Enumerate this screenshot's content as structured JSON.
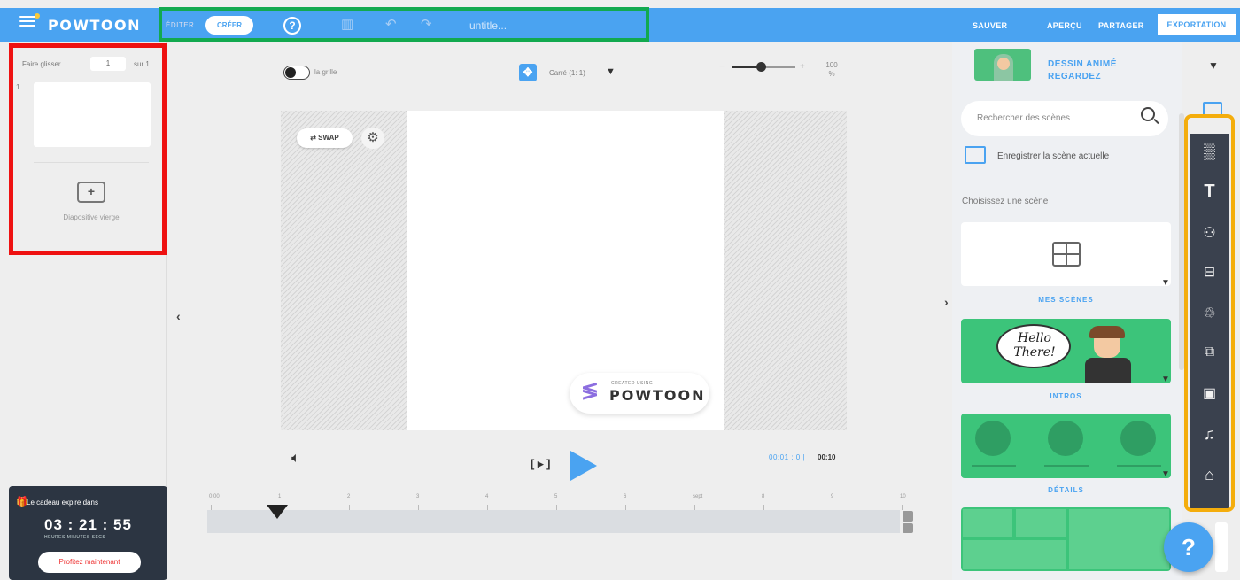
{
  "topbar": {
    "logo": "POWTOON",
    "mode_label": "ÉDITER",
    "mode_toggle": "CRÉER",
    "help_glyph": "?",
    "title": "untitle...",
    "actions": {
      "save": "SAUVER",
      "preview": "APERÇU",
      "share": "PARTAGER",
      "export": "EXPORTATION"
    }
  },
  "left_panel": {
    "drag_label": "Faire glisser",
    "page_value": "1",
    "of_label": "sur 1",
    "slide_number": "1",
    "add_slide_label": "Diapositive vierge",
    "timer": {
      "title": "Le cadeau expire dans",
      "digits": "03 : 21 : 55",
      "units": "HEURES  MINUTES  SECS",
      "button": "Profitez maintenant"
    }
  },
  "canvas_toolbar": {
    "grid_label": "la grille",
    "ratio_label": "Carré (1: 1)",
    "zoom_value": "100 %",
    "zoom_level": 0.45
  },
  "canvas": {
    "swap_label": "⇄ SWAP",
    "badge_small": "CREATED USING",
    "badge_name": "POWTOON"
  },
  "playback": {
    "step_label": "[ ▸ ]",
    "time_current": "00:01 : 0 |",
    "time_total": "00:10",
    "ruler": [
      "0:00",
      "1",
      "2",
      "3",
      "4",
      "5",
      "6",
      "sept",
      "8",
      "9",
      "10"
    ],
    "playhead_position": 1
  },
  "right_panel": {
    "header_title": "DESSIN ANIMÉ REGARDEZ",
    "search_placeholder": "Rechercher des scènes",
    "save_scene": "Enregistrer la scène actuelle",
    "choose_scene": "Choisissez une scène",
    "categories": [
      "MES SCÈNES",
      "INTROS",
      "DÉTAILS"
    ],
    "intro_bubble": "Hello There!"
  },
  "toolbar_icons": [
    "pattern-icon",
    "text-icon",
    "characters-icon",
    "props-icon",
    "shapes-icon",
    "media-icon",
    "video-icon",
    "music-icon",
    "upload-icon"
  ],
  "colors": {
    "brand_blue": "#4aa3f1",
    "green_highlight": "#12a94f",
    "red_highlight": "#ee1111",
    "orange_highlight": "#f4ad0c",
    "toolbar_dark": "#3a414e"
  }
}
